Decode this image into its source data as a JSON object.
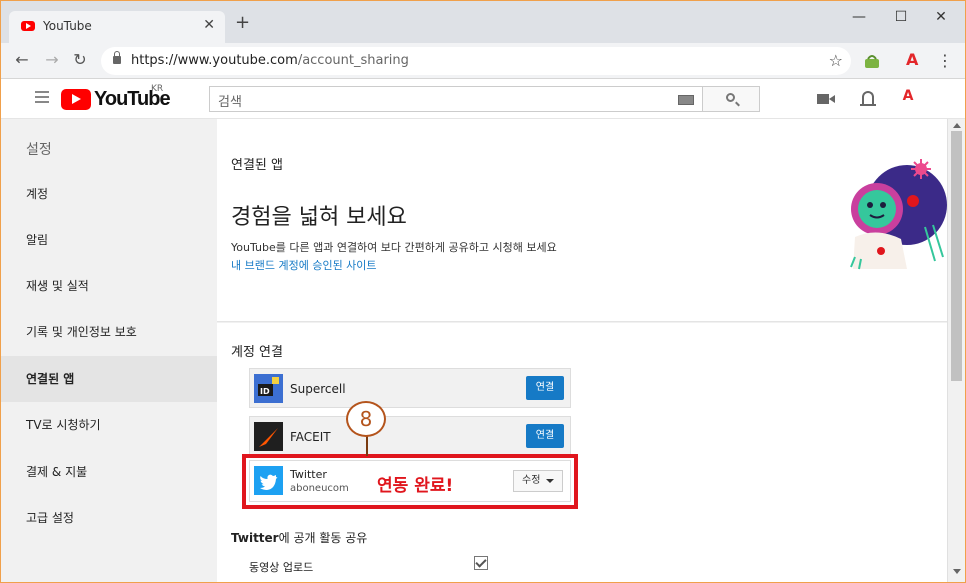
{
  "browser": {
    "tab_title": "YouTube",
    "tab_close": "✕",
    "new_tab": "+",
    "minimize": "—",
    "maximize": "☐",
    "close": "✕",
    "url_host": "https://www.youtube.com",
    "url_path": "/account_sharing"
  },
  "youtube": {
    "logo_text": "YouTube",
    "logo_region": "KR",
    "search_placeholder": "검색",
    "avatar_text": "A"
  },
  "sidebar": {
    "title": "설정",
    "items": [
      {
        "label": "계정"
      },
      {
        "label": "알림"
      },
      {
        "label": "재생 및 실적"
      },
      {
        "label": "기록 및 개인정보 보호"
      },
      {
        "label": "연결된 앱"
      },
      {
        "label": "TV로 시청하기"
      },
      {
        "label": "결제 & 지불"
      },
      {
        "label": "고급 설정"
      }
    ],
    "active_index": 4
  },
  "main": {
    "section_title": "연결된 앱",
    "heading": "경험을 넓혀 보세요",
    "description": "YouTube를 다른 앱과 연결하여 보다 간편하게 공유하고 시청해 보세요",
    "brand_link": "내 브랜드 계정에 승인된 사이트",
    "accounts_title": "계정 연결",
    "accounts": [
      {
        "name": "Supercell",
        "button": "연결"
      },
      {
        "name": "FACEIT",
        "button": "연결"
      }
    ],
    "twitter": {
      "name": "Twitter",
      "handle": "aboneucom",
      "edit_button": "수정"
    },
    "annotation_number": "8",
    "annotation_text": "연동 완료!",
    "share_title_bold": "Twitter",
    "share_title_rest": "에 공개 활동 공유",
    "upload_label": "동영상 업로드",
    "upload_checked": true
  },
  "colors": {
    "accent_blue": "#167ac6",
    "highlight_red": "#e0161d",
    "youtube_red": "#ff0000"
  }
}
